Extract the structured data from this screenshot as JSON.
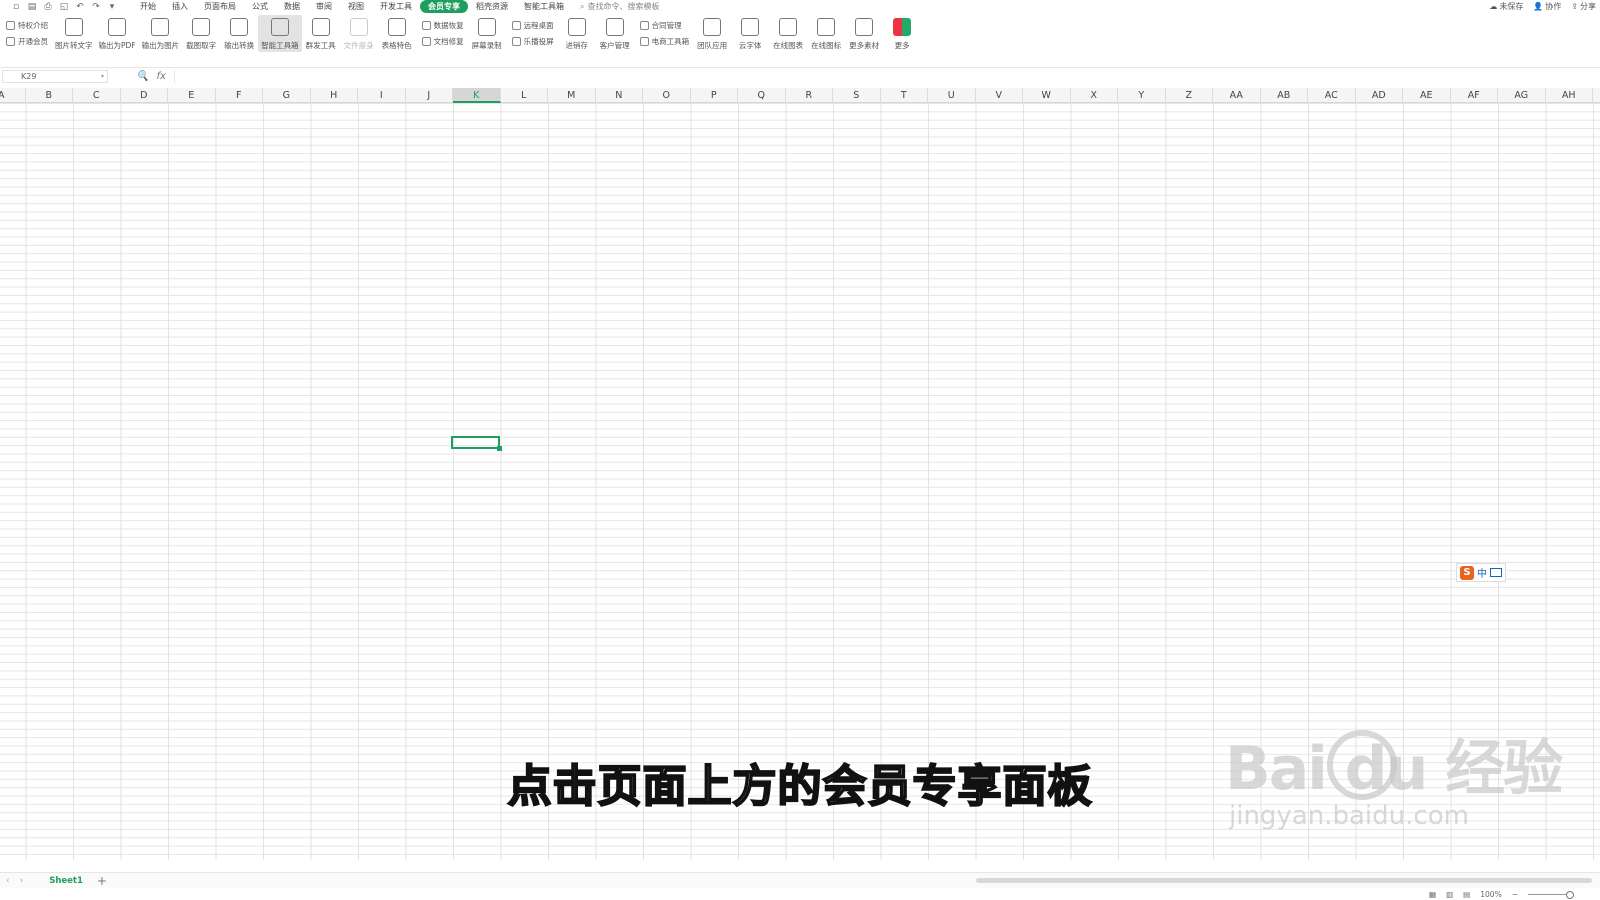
{
  "menubar": {
    "quick_access": [
      "save-icon",
      "template-icon",
      "print-icon",
      "preview-icon",
      "undo-icon",
      "redo-icon",
      "dropdown-icon"
    ],
    "tabs": [
      "开始",
      "插入",
      "页面布局",
      "公式",
      "数据",
      "审阅",
      "视图",
      "开发工具",
      "会员专享",
      "稻壳资源",
      "智能工具箱"
    ],
    "active_tab": "会员专享",
    "search_placeholder": "查找命令、搜索模板",
    "right": {
      "unsaved": "未保存",
      "collab": "协作",
      "share": "分享"
    }
  },
  "ribbon": {
    "small_left": [
      "特权介绍",
      "开通会员"
    ],
    "big_1": [
      {
        "label": "图片转文字",
        "icon": "image-text-icon"
      },
      {
        "label": "输出为PDF",
        "icon": "pdf-icon"
      },
      {
        "label": "输出为图片",
        "icon": "image-export-icon"
      },
      {
        "label": "截图取字",
        "icon": "screenshot-text-icon"
      },
      {
        "label": "输出转换",
        "icon": "convert-icon"
      },
      {
        "label": "智能工具箱",
        "icon": "toolbox-icon",
        "active": true
      },
      {
        "label": "群发工具",
        "icon": "broadcast-icon"
      },
      {
        "label": "文件瘦身",
        "icon": "file-slim-icon",
        "disabled": true
      },
      {
        "label": "表格特色",
        "icon": "table-feature-icon"
      }
    ],
    "small_mid": [
      "数据恢复",
      "文档修复"
    ],
    "big_2": [
      {
        "label": "屏幕录制",
        "icon": "screen-record-icon"
      }
    ],
    "small_mid2": [
      "远程桌面",
      "乐播投屏"
    ],
    "big_3": [
      {
        "label": "进销存",
        "icon": "inventory-icon"
      },
      {
        "label": "客户管理",
        "icon": "customer-icon"
      }
    ],
    "small_mid3": [
      "合同管理",
      "电商工具箱"
    ],
    "big_4": [
      {
        "label": "团队应用",
        "icon": "team-app-icon"
      },
      {
        "label": "云字体",
        "icon": "cloud-font-icon"
      },
      {
        "label": "在线图表",
        "icon": "online-chart-icon"
      },
      {
        "label": "在线图标",
        "icon": "online-icons-icon"
      },
      {
        "label": "更多素材",
        "icon": "more-material-icon"
      },
      {
        "label": "更多",
        "icon": "more-apps-icon"
      }
    ]
  },
  "formula_bar": {
    "cell_ref": "K29",
    "fx": "fx"
  },
  "columns": [
    "A",
    "B",
    "C",
    "D",
    "E",
    "F",
    "G",
    "H",
    "I",
    "J",
    "K",
    "L",
    "M",
    "N",
    "O",
    "P",
    "Q",
    "R",
    "S",
    "T",
    "U",
    "V",
    "W",
    "X",
    "Y",
    "Z",
    "AA",
    "AB",
    "AC",
    "AD",
    "AE",
    "AF",
    "AG",
    "AH"
  ],
  "selected_column": "K",
  "subtitle": "点击页面上方的会员专享面板",
  "watermark": {
    "brand": "Bai du 经验",
    "url": "jingyan.baidu.com"
  },
  "ime": {
    "label": "中"
  },
  "sheets": {
    "tabs": [
      "Sheet1"
    ],
    "add": "+"
  },
  "status": {
    "zoom": "100%"
  }
}
